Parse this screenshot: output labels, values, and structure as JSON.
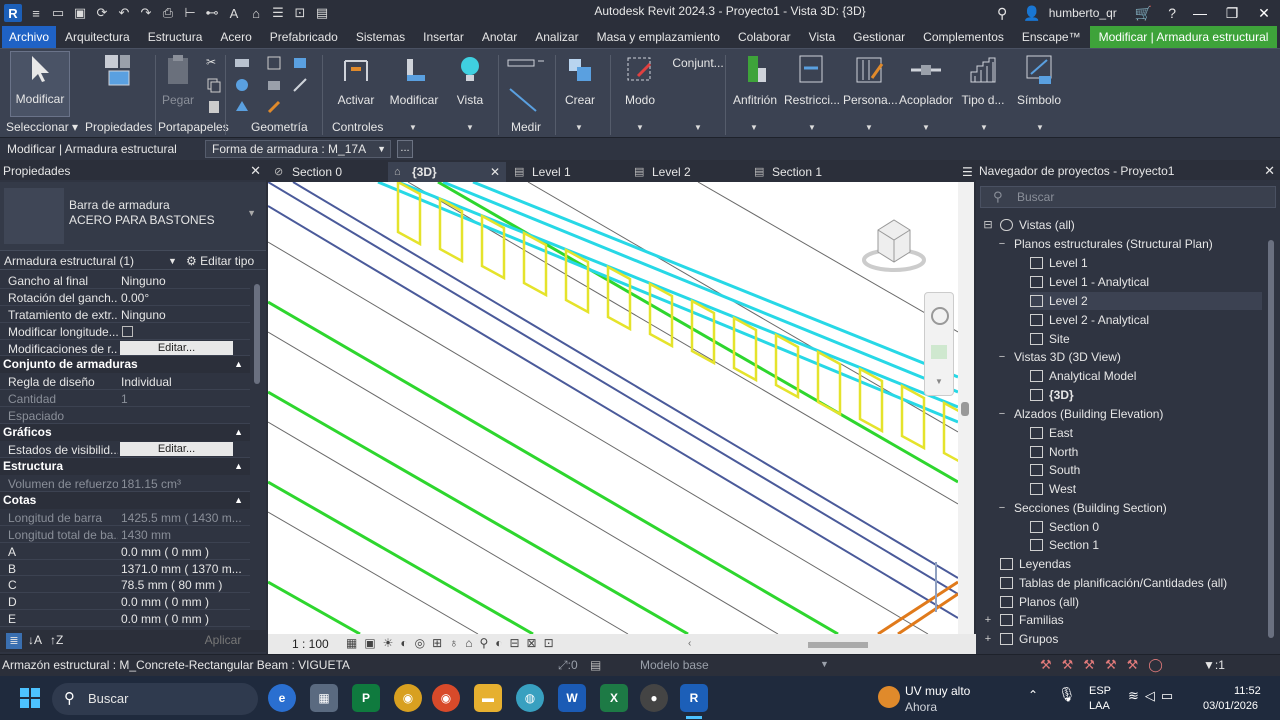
{
  "app": {
    "title": "Autodesk Revit 2024.3 - Proyecto1 - Vista 3D: {3D}",
    "username": "humberto_qr"
  },
  "menu": {
    "tabs": [
      "Archivo",
      "Arquitectura",
      "Estructura",
      "Acero",
      "Prefabricado",
      "Sistemas",
      "Insertar",
      "Anotar",
      "Analizar",
      "Masa y emplazamiento",
      "Colaborar",
      "Vista",
      "Gestionar",
      "Complementos",
      "Enscape™",
      "Modificar | Armadura estructural"
    ]
  },
  "ribbon": {
    "buttons": {
      "modificar": "Modificar",
      "propiedades": "Propiedades",
      "pegar": "Pegar",
      "activar": "Activar",
      "modificar2": "Modificar",
      "vista": "Vista",
      "crear": "Crear",
      "modo": "Modo",
      "conjunto": "Conjunt...",
      "anfitrion": "Anfitrión",
      "restricciones": "Restricci...",
      "personalizar": "Persona...",
      "acoplador": "Acoplador",
      "tipo": "Tipo d...",
      "simbolo": "Símbolo"
    },
    "groups": {
      "seleccionar": "Seleccionar",
      "propiedades": "Propiedades",
      "portapapeles": "Portapapeles",
      "geometria": "Geometría",
      "controles": "Controles",
      "medir": "Medir"
    }
  },
  "options_bar": {
    "context": "Modificar | Armadura estructural",
    "shape": "Forma de armadura : M_17A",
    "more": "..."
  },
  "properties": {
    "title": "Propiedades",
    "type_name_1": "Barra de armadura",
    "type_name_2": "ACERO PARA BASTONES",
    "instance": "Armadura estructural (1)",
    "edit_type": "Editar tipo",
    "rows_a": [
      {
        "k": "Gancho al final",
        "v": "Ninguno"
      },
      {
        "k": "Rotación del ganch...",
        "v": "0.00°"
      },
      {
        "k": "Tratamiento de extr...",
        "v": "Ninguno"
      }
    ],
    "mod_length": "Modificar longitude...",
    "mod_r": "Modificaciones de r...",
    "edit_btn": "Editar...",
    "sec_conjunto": "Conjunto de armaduras",
    "rows_b": [
      {
        "k": "Regla de diseño",
        "v": "Individual"
      },
      {
        "k": "Cantidad",
        "v": "1"
      },
      {
        "k": "Espaciado",
        "v": ""
      }
    ],
    "sec_graficos": "Gráficos",
    "visibility": "Estados de visibilid...",
    "sec_estructura": "Estructura",
    "volume": {
      "k": "Volumen de refuerzo",
      "v": "181.15 cm³"
    },
    "sec_cotas": "Cotas",
    "rows_c": [
      {
        "k": "Longitud de barra",
        "v": "1425.5 mm ( 1430 m..."
      },
      {
        "k": "Longitud total de ba...",
        "v": "1430 mm"
      },
      {
        "k": "A",
        "v": "0.0 mm ( 0 mm )"
      },
      {
        "k": "B",
        "v": "1371.0 mm ( 1370 m..."
      },
      {
        "k": "C",
        "v": "78.5 mm ( 80 mm )"
      },
      {
        "k": "D",
        "v": "0.0 mm ( 0 mm )"
      },
      {
        "k": "E",
        "v": "0.0 mm ( 0 mm )"
      }
    ],
    "apply": "Aplicar"
  },
  "view_tabs": [
    "Section 0",
    "{3D}",
    "Level 1",
    "Level 2",
    "Section 1"
  ],
  "view": {
    "scale": "1 : 100"
  },
  "navigator": {
    "title": "Navegador de proyectos - Proyecto1",
    "search_placeholder": "Buscar",
    "nodes": [
      "Vistas (all)",
      "Planos estructurales (Structural Plan)",
      "Level 1",
      "Level 1 - Analytical",
      "Level 2",
      "Level 2 - Analytical",
      "Site",
      "Vistas 3D (3D View)",
      "Analytical Model",
      "{3D}",
      "Alzados (Building Elevation)",
      "East",
      "North",
      "South",
      "West",
      "Secciones (Building Section)",
      "Section 0",
      "Section 1",
      "Leyendas",
      "Tablas de planificación/Cantidades (all)",
      "Planos (all)",
      "Familias",
      "Grupos"
    ]
  },
  "status": {
    "text": "Armazón estructural : M_Concrete-Rectangular Beam : VIGUETA",
    "worksets": ":0",
    "model": "Modelo base",
    "count": ":1"
  },
  "taskbar": {
    "search": "Buscar",
    "weather_1": "UV muy alto",
    "weather_2": "Ahora",
    "lang_1": "ESP",
    "lang_2": "LAA",
    "time": "11:52",
    "date": "03/01/2026"
  },
  "colors": {
    "accent": "#1f62c5",
    "context_tab": "#3ea33a",
    "rebar_cyan": "#27d8e6",
    "stirrup_yellow": "#e5e32b",
    "bar_green": "#2ed62e"
  }
}
